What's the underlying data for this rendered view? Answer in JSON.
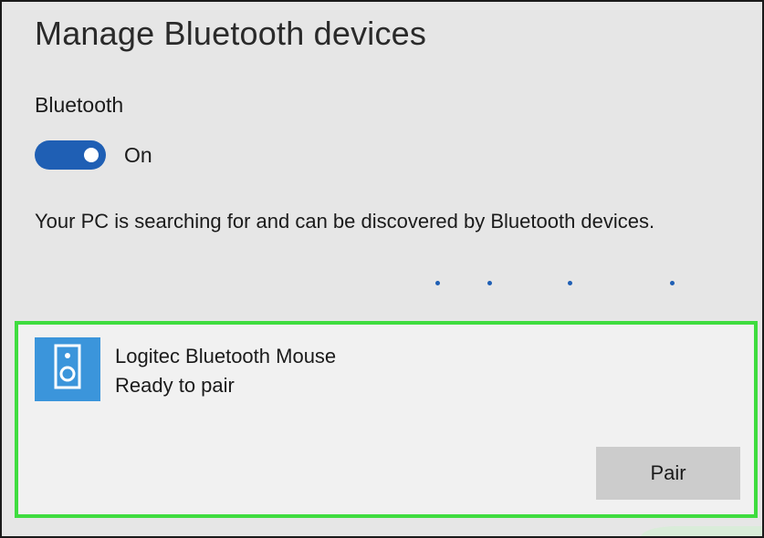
{
  "page": {
    "title": "Manage Bluetooth devices"
  },
  "bluetooth": {
    "label": "Bluetooth",
    "toggle_state": "On",
    "toggle_on": true,
    "status_text": "Your PC is searching for and can be discovered by Bluetooth devices."
  },
  "device": {
    "icon": "speaker-icon",
    "name": "Logitec Bluetooth Mouse",
    "status": "Ready to pair",
    "pair_label": "Pair"
  },
  "colors": {
    "accent": "#1f5fb4",
    "device_icon_bg": "#3b95db",
    "highlight_border": "#3fdc3f",
    "page_bg": "#e6e6e6",
    "card_bg": "#f1f1f1",
    "button_bg": "#cccccc"
  }
}
